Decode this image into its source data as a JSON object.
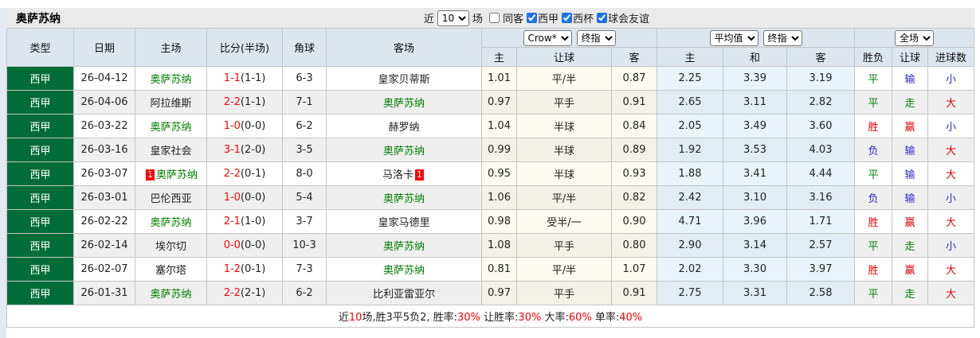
{
  "title_bar": {
    "team_name": "奥萨苏纳",
    "recent_label": "近",
    "matches_count": "10",
    "matches_label": "场",
    "checkboxes": [
      {
        "label": "同客",
        "checked": false
      },
      {
        "label": "西甲",
        "checked": true
      },
      {
        "label": "西杯",
        "checked": true
      },
      {
        "label": "球会友谊",
        "checked": true
      }
    ]
  },
  "colors": {
    "league_green": "#006d38",
    "team_green": "#008000",
    "score_red": "#ff0000",
    "accent_blue": "#1a73e8"
  },
  "result_colors": {
    "胜": "#e60000",
    "平": "#008000",
    "负": "#2a2ad0",
    "赢": "#e60000",
    "走": "#008000",
    "输": "#2a2ad0",
    "大": "#e60000",
    "小": "#2a2ad0"
  },
  "table": {
    "left_headers": [
      "类型",
      "日期",
      "主场",
      "比分(半场)",
      "角球",
      "客场"
    ],
    "handicap_group": {
      "bookmaker_dropdown": "Crow*",
      "time_dropdown": "终指",
      "columns": [
        "主",
        "让球",
        "客"
      ]
    },
    "europe_group": {
      "source_dropdown": "平均值",
      "time_dropdown": "终指",
      "columns": [
        "主",
        "和",
        "客"
      ]
    },
    "result_group": {
      "scope_dropdown": "全场",
      "columns": [
        "胜负",
        "让球",
        "进球数"
      ]
    },
    "rows": [
      {
        "league": "西甲",
        "date": "26-04-12",
        "home_badge": "",
        "home": "奥萨苏纳",
        "score": "1-1",
        "half_score": "(1-1)",
        "corner": "6-3",
        "away": "皇家贝蒂斯",
        "away_badge": "",
        "h_home": "1.01",
        "h_line": "平/半",
        "h_away": "0.87",
        "e_home": "2.25",
        "e_draw": "3.39",
        "e_away": "3.19",
        "result": "平",
        "handicap_result": "输",
        "goals": "小"
      },
      {
        "league": "西甲",
        "date": "26-04-06",
        "home_badge": "",
        "home": "阿拉维斯",
        "score": "2-2",
        "half_score": "(1-1)",
        "corner": "7-1",
        "away": "奥萨苏纳",
        "away_badge": "",
        "h_home": "0.97",
        "h_line": "平手",
        "h_away": "0.91",
        "e_home": "2.65",
        "e_draw": "3.11",
        "e_away": "2.82",
        "result": "平",
        "handicap_result": "走",
        "goals": "大"
      },
      {
        "league": "西甲",
        "date": "26-03-22",
        "home_badge": "",
        "home": "奥萨苏纳",
        "score": "1-0",
        "half_score": "(0-0)",
        "corner": "6-2",
        "away": "赫罗纳",
        "away_badge": "",
        "h_home": "1.04",
        "h_line": "半球",
        "h_away": "0.84",
        "e_home": "2.05",
        "e_draw": "3.49",
        "e_away": "3.60",
        "result": "胜",
        "handicap_result": "赢",
        "goals": "小"
      },
      {
        "league": "西甲",
        "date": "26-03-16",
        "home_badge": "",
        "home": "皇家社会",
        "score": "3-1",
        "half_score": "(2-0)",
        "corner": "3-5",
        "away": "奥萨苏纳",
        "away_badge": "",
        "h_home": "0.99",
        "h_line": "半球",
        "h_away": "0.89",
        "e_home": "1.92",
        "e_draw": "3.53",
        "e_away": "4.03",
        "result": "负",
        "handicap_result": "输",
        "goals": "大"
      },
      {
        "league": "西甲",
        "date": "26-03-07",
        "home_badge": "1",
        "home": "奥萨苏纳",
        "score": "2-2",
        "half_score": "(0-1)",
        "corner": "8-0",
        "away": "马洛卡",
        "away_badge": "1",
        "h_home": "0.95",
        "h_line": "半球",
        "h_away": "0.93",
        "e_home": "1.88",
        "e_draw": "3.41",
        "e_away": "4.44",
        "result": "平",
        "handicap_result": "输",
        "goals": "大"
      },
      {
        "league": "西甲",
        "date": "26-03-01",
        "home_badge": "",
        "home": "巴伦西亚",
        "score": "1-0",
        "half_score": "(0-0)",
        "corner": "5-4",
        "away": "奥萨苏纳",
        "away_badge": "",
        "h_home": "1.06",
        "h_line": "平/半",
        "h_away": "0.82",
        "e_home": "2.42",
        "e_draw": "3.10",
        "e_away": "3.16",
        "result": "负",
        "handicap_result": "输",
        "goals": "小"
      },
      {
        "league": "西甲",
        "date": "26-02-22",
        "home_badge": "",
        "home": "奥萨苏纳",
        "score": "2-1",
        "half_score": "(1-0)",
        "corner": "3-7",
        "away": "皇家马德里",
        "away_badge": "",
        "h_home": "0.98",
        "h_line": "受半/一",
        "h_away": "0.90",
        "e_home": "4.71",
        "e_draw": "3.96",
        "e_away": "1.71",
        "result": "胜",
        "handicap_result": "赢",
        "goals": "大"
      },
      {
        "league": "西甲",
        "date": "26-02-14",
        "home_badge": "",
        "home": "埃尔切",
        "score": "0-0",
        "half_score": "(0-0)",
        "corner": "10-3",
        "away": "奥萨苏纳",
        "away_badge": "",
        "h_home": "1.08",
        "h_line": "平手",
        "h_away": "0.80",
        "e_home": "2.90",
        "e_draw": "3.14",
        "e_away": "2.57",
        "result": "平",
        "handicap_result": "走",
        "goals": "小"
      },
      {
        "league": "西甲",
        "date": "26-02-07",
        "home_badge": "",
        "home": "塞尔塔",
        "score": "1-2",
        "half_score": "(0-1)",
        "corner": "7-3",
        "away": "奥萨苏纳",
        "away_badge": "",
        "h_home": "0.81",
        "h_line": "平/半",
        "h_away": "1.07",
        "e_home": "2.02",
        "e_draw": "3.30",
        "e_away": "3.97",
        "result": "胜",
        "handicap_result": "赢",
        "goals": "大"
      },
      {
        "league": "西甲",
        "date": "26-01-31",
        "home_badge": "",
        "home": "奥萨苏纳",
        "score": "2-2",
        "half_score": "(2-1)",
        "corner": "6-2",
        "away": "比利亚雷亚尔",
        "away_badge": "",
        "h_home": "0.97",
        "h_line": "平手",
        "h_away": "0.91",
        "e_home": "2.75",
        "e_draw": "3.31",
        "e_away": "2.58",
        "result": "平",
        "handicap_result": "走",
        "goals": "大"
      }
    ]
  },
  "footer_segments": [
    {
      "text": "近",
      "red": false
    },
    {
      "text": "10",
      "red": true
    },
    {
      "text": "场,胜3平5负2, 胜率:",
      "red": false
    },
    {
      "text": "30%",
      "red": true
    },
    {
      "text": " 让胜率:",
      "red": false
    },
    {
      "text": "30%",
      "red": true
    },
    {
      "text": " 大率:",
      "red": false
    },
    {
      "text": "60%",
      "red": true
    },
    {
      "text": " 单率:",
      "red": false
    },
    {
      "text": "40%",
      "red": true
    }
  ]
}
